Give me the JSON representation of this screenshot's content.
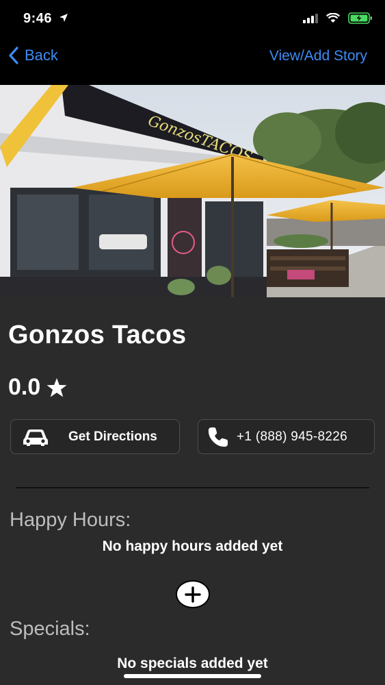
{
  "status_bar": {
    "time": "9:46"
  },
  "nav": {
    "back_label": "Back",
    "story_label": "View/Add Story"
  },
  "restaurant": {
    "name": "Gonzos Tacos",
    "rating": "0.0"
  },
  "actions": {
    "directions_label": "Get Directions",
    "phone_label": "+1 (888) 945-8226"
  },
  "happy_hours": {
    "label": "Happy Hours:",
    "empty_message": "No happy hours added yet"
  },
  "specials": {
    "label": "Specials:",
    "empty_message": "No specials added yet"
  },
  "hero": {
    "sign_text": "GonzosTACOS"
  },
  "colors": {
    "accent": "#3e8cf5",
    "background": "#2b2b2b",
    "umbrella": "#f2b52e"
  },
  "icons": [
    "location-arrow-icon",
    "signal-icon",
    "wifi-icon",
    "battery-icon",
    "chevron-left-icon",
    "star-icon",
    "car-icon",
    "phone-icon",
    "plus-icon"
  ]
}
